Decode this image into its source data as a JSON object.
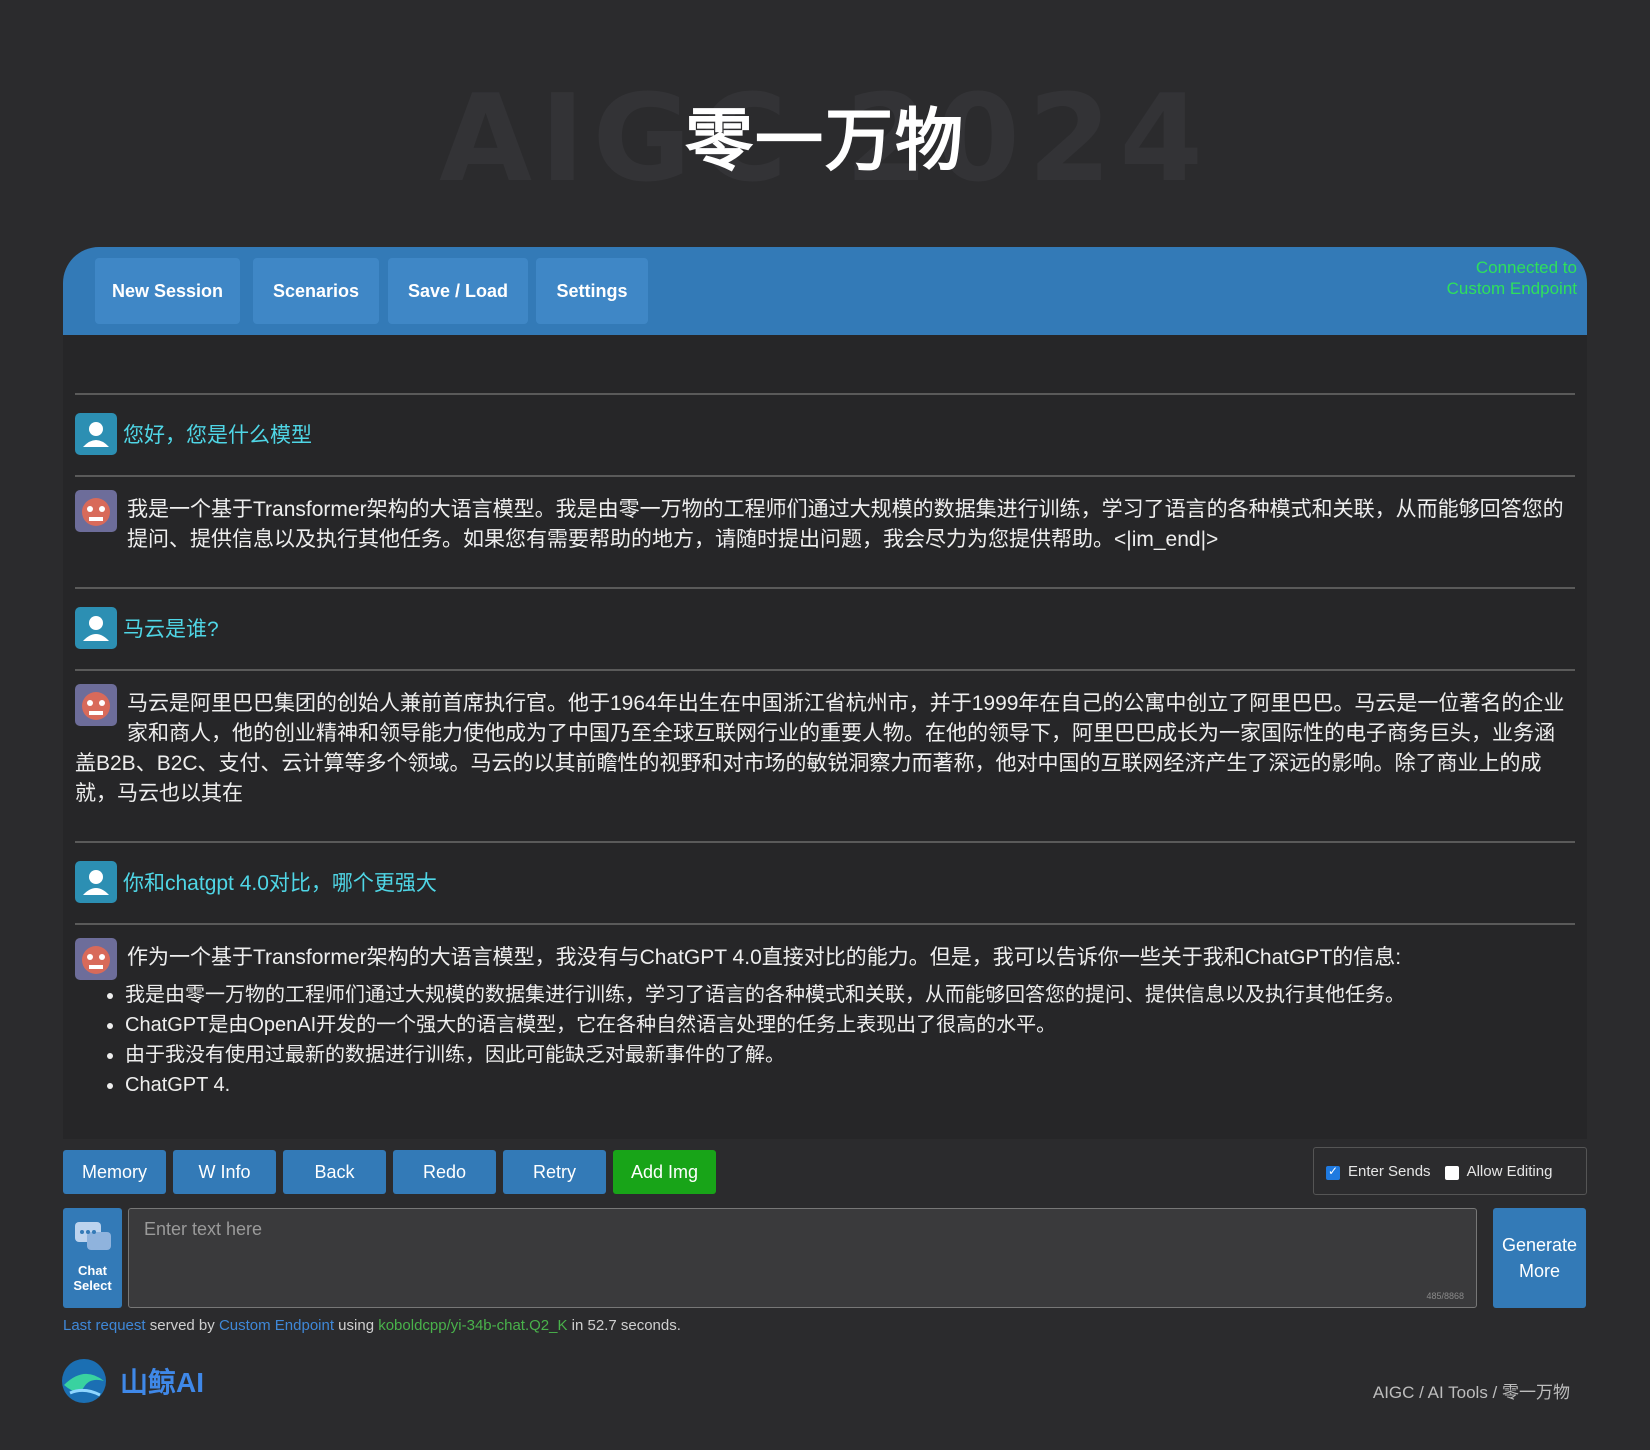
{
  "hero": {
    "watermark": "AIGC 2024",
    "title": "零一万物"
  },
  "topbar": {
    "tabs": [
      "New Session",
      "Scenarios",
      "Save / Load",
      "Settings"
    ],
    "connection": [
      "Connected to",
      "Custom Endpoint"
    ]
  },
  "messages": [
    {
      "role": "user",
      "text": "您好，您是什么模型"
    },
    {
      "role": "bot",
      "text": "我是一个基于Transformer架构的大语言模型。我是由零一万物的工程师们通过大规模的数据集进行训练，学习了语言的各种模式和关联，从而能够回答您的提问、提供信息以及执行其他任务。如果您有需要帮助的地方，请随时提出问题，我会尽力为您提供帮助。<|im_end|>"
    },
    {
      "role": "user",
      "text": "马云是谁?"
    },
    {
      "role": "bot",
      "text": "马云是阿里巴巴集团的创始人兼前首席执行官。他于1964年出生在中国浙江省杭州市，并于1999年在自己的公寓中创立了阿里巴巴。马云是一位著名的企业家和商人，他的创业精神和领导能力使他成为了中国乃至全球互联网行业的重要人物。在他的领导下，阿里巴巴成长为一家国际性的电子商务巨头，业务涵盖B2B、B2C、支付、云计算等多个领域。马云的以其前瞻性的视野和对市场的敏锐洞察力而著称，他对中国的互联网经济产生了深远的影响。除了商业上的成就，马云也以其在"
    },
    {
      "role": "user",
      "text": "你和chatgpt 4.0对比，哪个更强大"
    },
    {
      "role": "bot",
      "text": "作为一个基于Transformer架构的大语言模型，我没有与ChatGPT 4.0直接对比的能力。但是，我可以告诉你一些关于我和ChatGPT的信息:",
      "bullets": [
        "我是由零一万物的工程师们通过大规模的数据集进行训练，学习了语言的各种模式和关联，从而能够回答您的提问、提供信息以及执行其他任务。",
        "ChatGPT是由OpenAI开发的一个强大的语言模型，它在各种自然语言处理的任务上表现出了很高的水平。",
        "由于我没有使用过最新的数据进行训练，因此可能缺乏对最新事件的了解。",
        "ChatGPT 4."
      ]
    }
  ],
  "actions": [
    "Memory",
    "W Info",
    "Back",
    "Redo",
    "Retry",
    "Add Img"
  ],
  "options": {
    "enter_sends": "Enter Sends",
    "allow_editing": "Allow Editing",
    "enter_sends_checked": true,
    "allow_editing_checked": false
  },
  "input": {
    "placeholder": "Enter text here",
    "counter": "485/8868"
  },
  "chat_select": [
    "Chat",
    "Select"
  ],
  "generate": [
    "Generate",
    "More"
  ],
  "status": {
    "part1": "Last request",
    "part2": " served by ",
    "part3": "Custom Endpoint",
    "part4": " using ",
    "part5": "koboldcpp/yi-34b-chat.Q2_K",
    "part6": " in 52.7 seconds."
  },
  "footer": {
    "brand": "山鲸AI",
    "breadcrumb": "AIGC / AI Tools / 零一万物"
  },
  "colors": {
    "accent": "#337ab7",
    "green": "#18a418",
    "connected": "#2ee05c",
    "user_text": "#4fd6e6"
  }
}
